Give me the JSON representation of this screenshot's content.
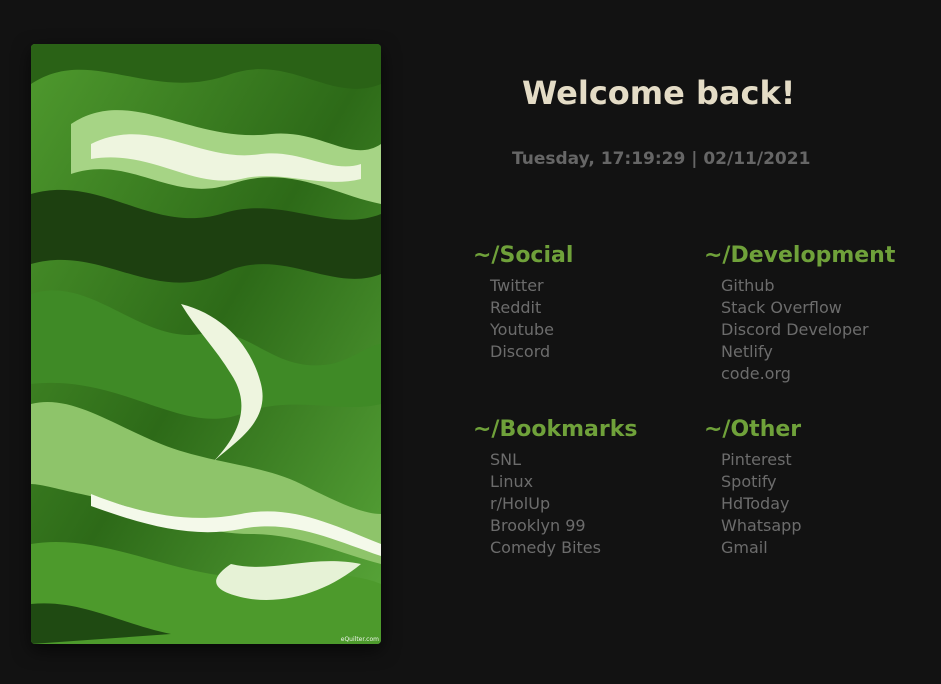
{
  "welcome": "Welcome back!",
  "datetime": "Tuesday, 17:19:29 | 02/11/2021",
  "art": {
    "watermark": "eQuilter.com",
    "colors": {
      "dark": "#1d4010",
      "mid": "#3f8a26",
      "light": "#8ec46a",
      "highlight": "#eef5df"
    }
  },
  "colors": {
    "background": "#121212",
    "accent": "#6fa13a",
    "heading": "#e4dcc6",
    "link": "#6c6c6c"
  },
  "sections": [
    {
      "title": "~/Social",
      "links": [
        "Twitter",
        "Reddit",
        "Youtube",
        "Discord"
      ]
    },
    {
      "title": "~/Development",
      "links": [
        "Github",
        "Stack Overflow",
        "Discord Developer",
        "Netlify",
        "code.org"
      ]
    },
    {
      "title": "~/Bookmarks",
      "links": [
        "SNL",
        "Linux",
        "r/HolUp",
        "Brooklyn 99",
        "Comedy Bites"
      ]
    },
    {
      "title": "~/Other",
      "links": [
        "Pinterest",
        "Spotify",
        "HdToday",
        "Whatsapp",
        "Gmail"
      ]
    }
  ]
}
